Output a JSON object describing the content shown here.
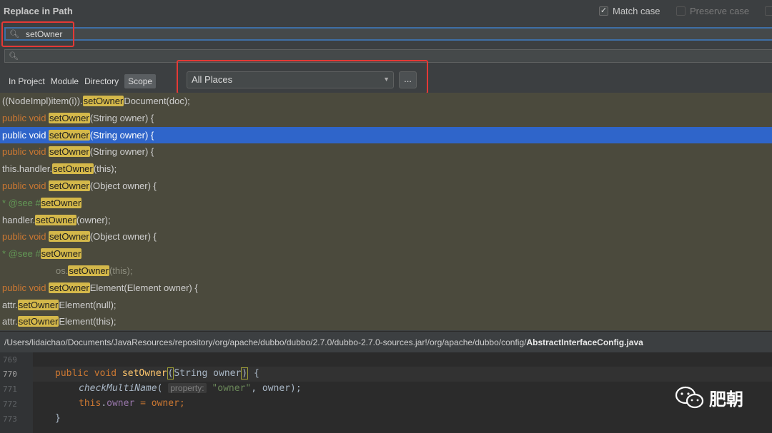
{
  "dialog": {
    "title": "Replace in Path",
    "match_case_label": "Match case",
    "preserve_case_label": "Preserve case",
    "match_case_checked": true,
    "preserve_case_checked": false
  },
  "search": {
    "value": "setOwner",
    "icon": "search-icon"
  },
  "replace": {
    "value": "",
    "icon": "search-icon"
  },
  "scopes": [
    "In Project",
    "Module",
    "Directory",
    "Scope"
  ],
  "active_scope": "Scope",
  "scope_select": {
    "value": "All Places",
    "browse_label": "..."
  },
  "results": [
    {
      "pre": "((NodeImpl)item(i)).",
      "match": "setOwner",
      "post": "Document(doc);"
    },
    {
      "pre": "public void ",
      "match": "setOwner",
      "post": "(String owner) {"
    },
    {
      "pre": "public void ",
      "match": "setOwner",
      "post": "(String owner) {"
    },
    {
      "pre": "public void ",
      "match": "setOwner",
      "post": "(String owner) {"
    },
    {
      "pre": "this.handler.",
      "match": "setOwner",
      "post": "(this);"
    },
    {
      "pre": "public void ",
      "match": "setOwner",
      "post": "(Object owner) {"
    },
    {
      "pre": "* @see #",
      "match": "setOwner",
      "post": ""
    },
    {
      "pre": "handler.",
      "match": "setOwner",
      "post": "(owner);"
    },
    {
      "pre": "public void ",
      "match": "setOwner",
      "post": "(Object owner) {"
    },
    {
      "pre": "* @see #",
      "match": "setOwner",
      "post": ""
    },
    {
      "pre": "os.",
      "match": "setOwner",
      "post": "(this);"
    },
    {
      "pre": "public void ",
      "match": "setOwner",
      "post": "Element(Element owner) {"
    },
    {
      "pre": "attr.",
      "match": "setOwner",
      "post": "Element(null);"
    },
    {
      "pre": "attr.",
      "match": "setOwner",
      "post": "Element(this);"
    }
  ],
  "selected_result_index": 2,
  "file_path": {
    "dir": "/Users/lidaichao/Documents/JavaResources/repository/org/apache/dubbo/dubbo/2.7.0/dubbo-2.7.0-sources.jar!/org/apache/dubbo/config/",
    "file": "AbstractInterfaceConfig.java"
  },
  "editor": {
    "line_numbers": [
      "769",
      "770",
      "771",
      "772",
      "773"
    ],
    "current_line": "770",
    "code": {
      "l770_kw": "public void ",
      "l770_method": "setOwner",
      "l770_open": "(",
      "l770_rest": "String owner",
      "l770_close": ")",
      "l770_end": " {",
      "l771_call": "checkMultiName",
      "l771_open": "( ",
      "l771_hint": "property:",
      "l771_str": "\"owner\"",
      "l771_end": ", owner);",
      "l772_this": "this",
      "l772_dot": ".",
      "l772_field": "owner",
      "l772_end": " = owner;",
      "l773": "}"
    }
  },
  "watermark": {
    "text": "肥朝"
  },
  "colors": {
    "accent": "#2f65ca",
    "highlight": "#d4b84a",
    "annotation_box": "#e53935"
  }
}
